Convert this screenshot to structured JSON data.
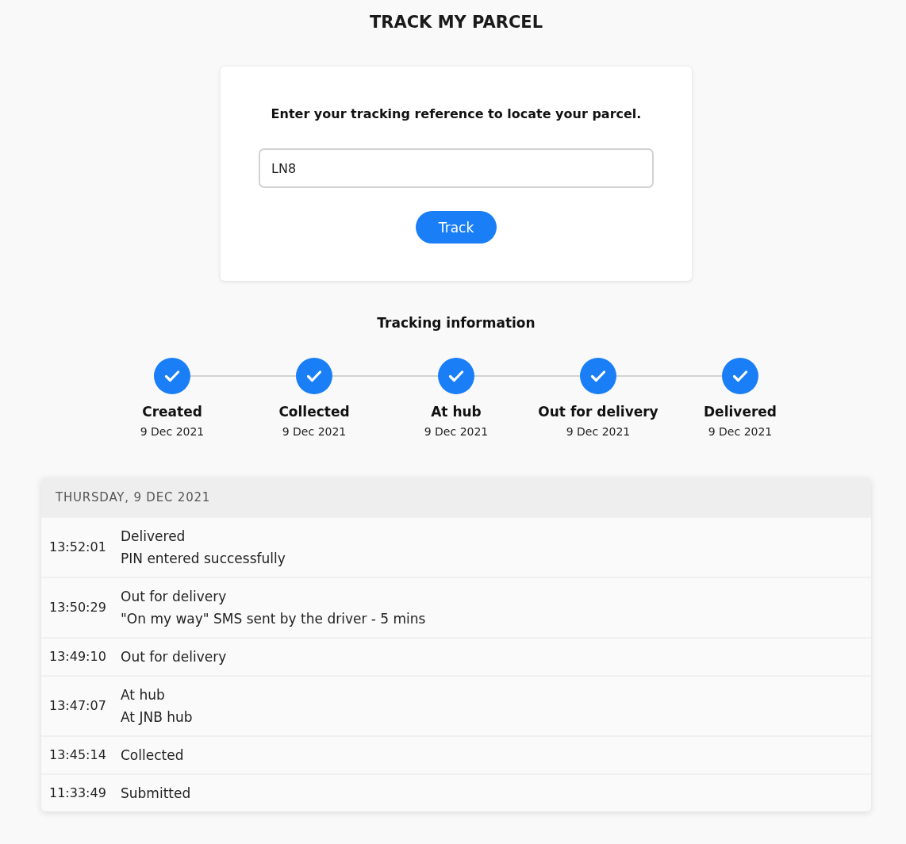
{
  "page": {
    "title": "TRACK MY PARCEL"
  },
  "search": {
    "prompt": "Enter your tracking reference to locate your parcel.",
    "value": "LN8",
    "button": "Track"
  },
  "tracking": {
    "heading": "Tracking information",
    "steps": [
      {
        "label": "Created",
        "date": "9 Dec 2021",
        "completed": true
      },
      {
        "label": "Collected",
        "date": "9 Dec 2021",
        "completed": true
      },
      {
        "label": "At hub",
        "date": "9 Dec 2021",
        "completed": true
      },
      {
        "label": "Out for delivery",
        "date": "9 Dec 2021",
        "completed": true
      },
      {
        "label": "Delivered",
        "date": "9 Dec 2021",
        "completed": true
      }
    ]
  },
  "history": {
    "day": "THURSDAY, 9 DEC 2021",
    "events": [
      {
        "time": "13:52:01",
        "status": "Delivered",
        "detail": "PIN entered successfully"
      },
      {
        "time": "13:50:29",
        "status": "Out for delivery",
        "detail": "\"On my way\" SMS sent by the driver - 5 mins"
      },
      {
        "time": "13:49:10",
        "status": "Out for delivery"
      },
      {
        "time": "13:47:07",
        "status": "At hub",
        "detail": "At JNB hub"
      },
      {
        "time": "13:45:14",
        "status": "Collected"
      },
      {
        "time": "11:33:49",
        "status": "Submitted"
      }
    ]
  }
}
